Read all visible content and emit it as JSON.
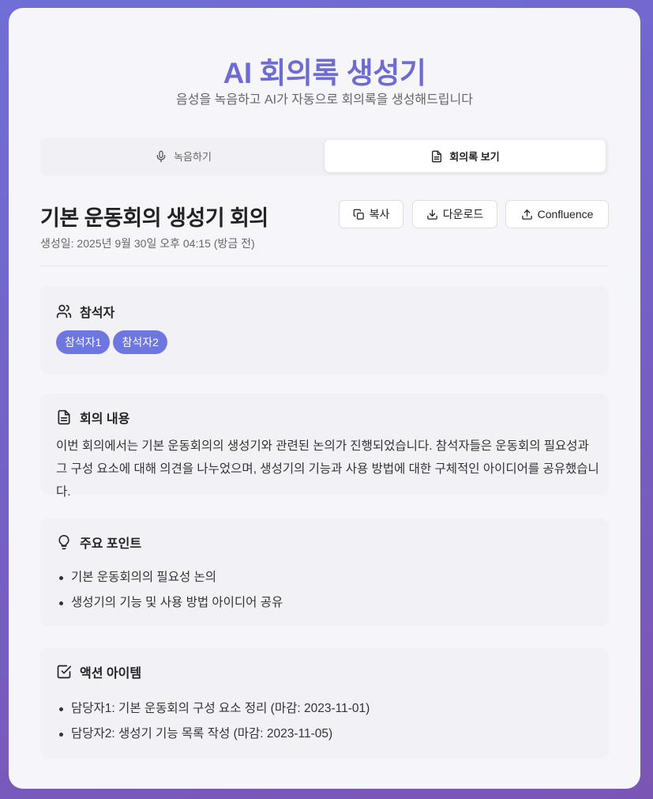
{
  "header": {
    "title": "AI 회의록 생성기",
    "subtitle": "음성을 녹음하고 AI가 자동으로 회의록을 생성해드립니다"
  },
  "tabs": [
    {
      "label": "녹음하기",
      "icon": "mic-icon",
      "active": false
    },
    {
      "label": "회의록 보기",
      "icon": "document-icon",
      "active": true
    }
  ],
  "document": {
    "title": "기본 운동회의 생성기 회의",
    "created": "생성일: 2025년 9월 30일 오후 04:15 (방금 전)"
  },
  "actions": {
    "copy_label": "복사",
    "download_label": "다운로드",
    "confluence_label": "Confluence"
  },
  "participants": {
    "heading": "참석자",
    "icon": "users-icon",
    "items": [
      "참석자1",
      "참석자2"
    ]
  },
  "content": {
    "heading": "회의 내용",
    "icon": "document-icon",
    "text": "이번 회의에서는 기본 운동회의의 생성기와 관련된 논의가 진행되었습니다. 참석자들은 운동회의 필요성과 그 구성 요소에 대해 의견을 나누었으며, 생성기의 기능과 사용 방법에 대한 구체적인 아이디어를 공유했습니다."
  },
  "key_points": {
    "heading": "주요 포인트",
    "icon": "lightbulb-icon",
    "items": [
      "기본 운동회의의 필요성 논의",
      "생성기의 기능 및 사용 방법 아이디어 공유"
    ]
  },
  "action_items": {
    "heading": "액션 아이템",
    "icon": "checkbox-icon",
    "items": [
      "담당자1: 기본 운동회의 구성 요소 정리 (마감: 2023-11-01)",
      "담당자2: 생성기 기능 목록 작성 (마감: 2023-11-05)"
    ]
  },
  "colors": {
    "accent": "#6e6bd4",
    "chip": "#6e77e0",
    "background_gradient_start": "#6f6fd6",
    "background_gradient_end": "#7b55b4"
  }
}
